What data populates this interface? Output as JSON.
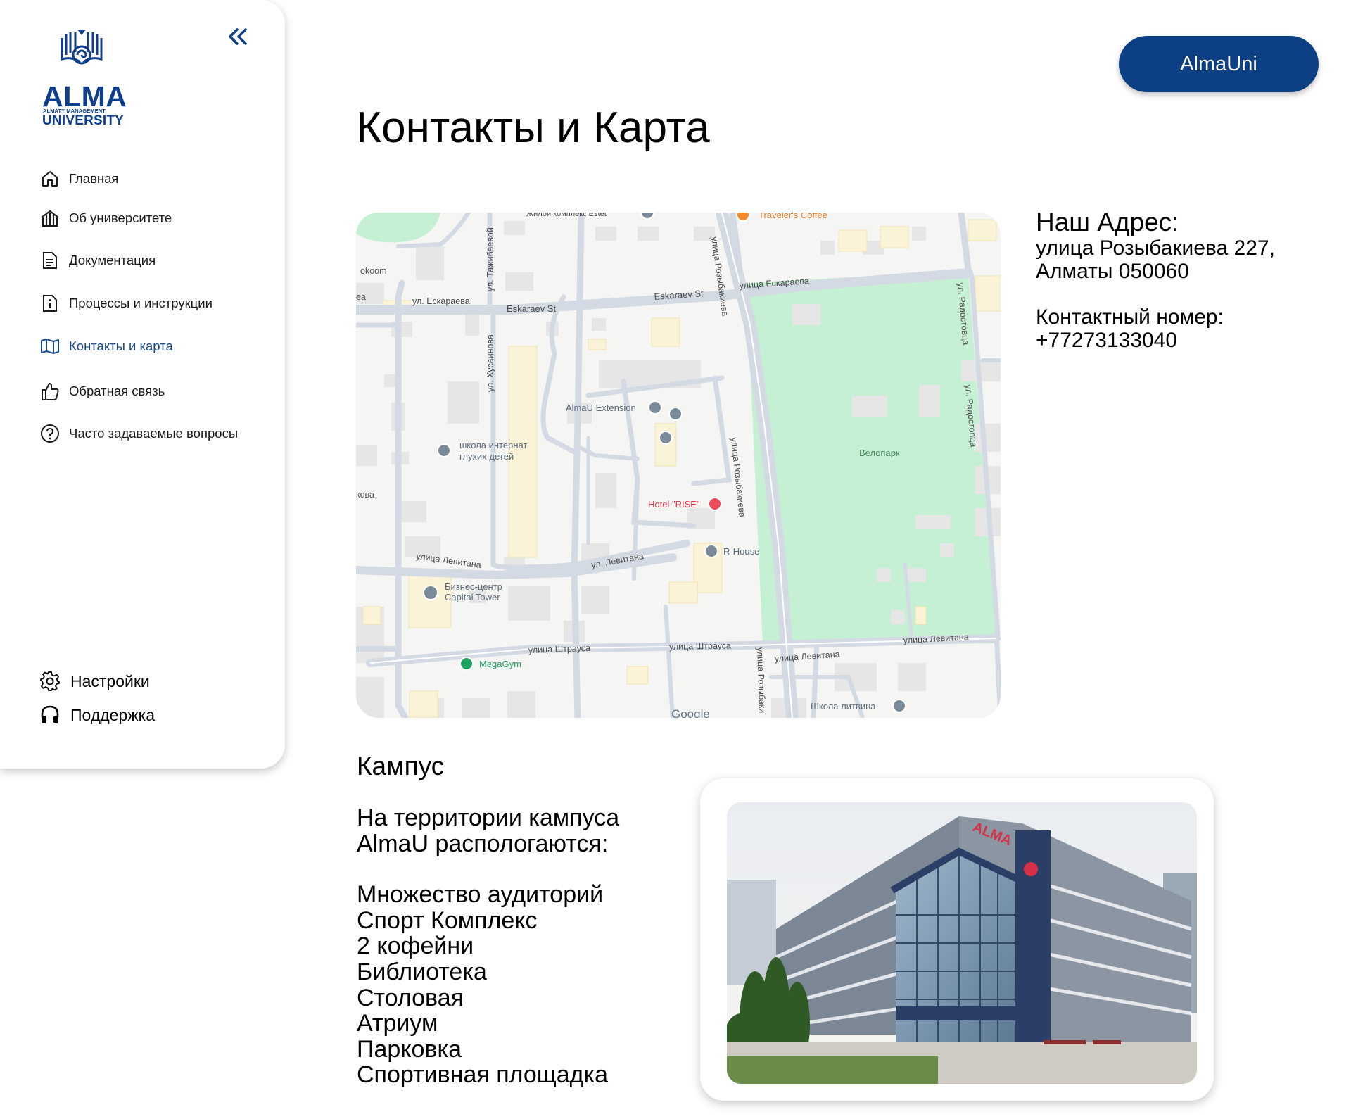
{
  "brand": {
    "logo_title": "ALMA",
    "logo_sub1": "ALMATY MANAGEMENT",
    "logo_sub2": "UNIVERSITY",
    "accent": "#0d3f85"
  },
  "sidebar": {
    "items": [
      {
        "label": "Главная",
        "icon": "home-icon"
      },
      {
        "label": "Об университете",
        "icon": "university-icon"
      },
      {
        "label": "Документация",
        "icon": "document-icon"
      },
      {
        "label": "Процессы и инструкции",
        "icon": "info-document-icon"
      },
      {
        "label": "Контакты и карта",
        "icon": "map-icon",
        "active": true
      },
      {
        "label": "Обратная связь",
        "icon": "thumbs-up-icon"
      },
      {
        "label": "Часто задаваемые вопросы",
        "icon": "question-icon"
      }
    ],
    "bottom": [
      {
        "label": "Настройки",
        "icon": "gear-icon"
      },
      {
        "label": "Поддержка",
        "icon": "headphones-icon"
      }
    ]
  },
  "header": {
    "brand_button": "AlmaUni",
    "page_title": "Контакты и Карта"
  },
  "map": {
    "labels": {
      "zhk": "Жилой комплекс Estet",
      "travelers": "Traveler's Coffee",
      "okoom": "okoom",
      "eskaraeva_left": "ул. Ескараева",
      "eskaraev_st": "Eskaraev St",
      "eskaraev_st2": "Eskaraev St",
      "eskaraeva_right": "улица Ескараева",
      "tazhibaevoy": "ул. Тажибаевой",
      "rozybakieva_top": "улица Розыбакиева",
      "rozybakieva_mid": "улица Розыбакиева",
      "rozybakieva_bot": "улица Розыбаки",
      "radostovtsa_1": "ул. Радостовца",
      "radostovtsa_2": "ул. Радостовца",
      "khusainova": "ул. Хусаинова",
      "almau_ext": "AlmaU Extension",
      "school_deaf_1": "школа интернат",
      "school_deaf_2": "глухих детей",
      "velopark": "Велопарк",
      "hotel": "Hotel \"RISE\"",
      "rhouse": "R-House",
      "kova": "кова",
      "levitana_1": "улица Левитана",
      "levitana_2": "ул. Левитана",
      "levitana_3": "улица Левитана",
      "levitana_4": "улица Левитана",
      "bc_1": "Бизнес-центр",
      "bc_2": "Capital Tower",
      "shtrausa_1": "улица Штрауса",
      "shtrausa_2": "улица Штрауса",
      "megagym": "MegaGym",
      "school_litvina": "Школа литвина",
      "google": "Google",
      "ea": "ea"
    },
    "colors": {
      "park": "#c5f0d3",
      "road": "#d3dae3",
      "building": "#e6e6e6",
      "highlight": "#fbf3d8"
    }
  },
  "address": {
    "title": "Наш Адрес:",
    "line1": "улица Розыбакиева 227,",
    "line2": "Алматы 050060",
    "phone_title": "Контактный номер:",
    "phone": "+77273133040"
  },
  "campus": {
    "title": "Кампус",
    "intro_1": "На территории кампуса",
    "intro_2": "AlmaU распологаются:",
    "list": [
      "Множество аудиторий",
      "Спорт Комплекс",
      "2 кофейни",
      "Библиотека",
      "Столовая",
      "Атриум",
      "Парковка",
      "Спортивная площадка"
    ],
    "photo_sign": "ALMA"
  }
}
